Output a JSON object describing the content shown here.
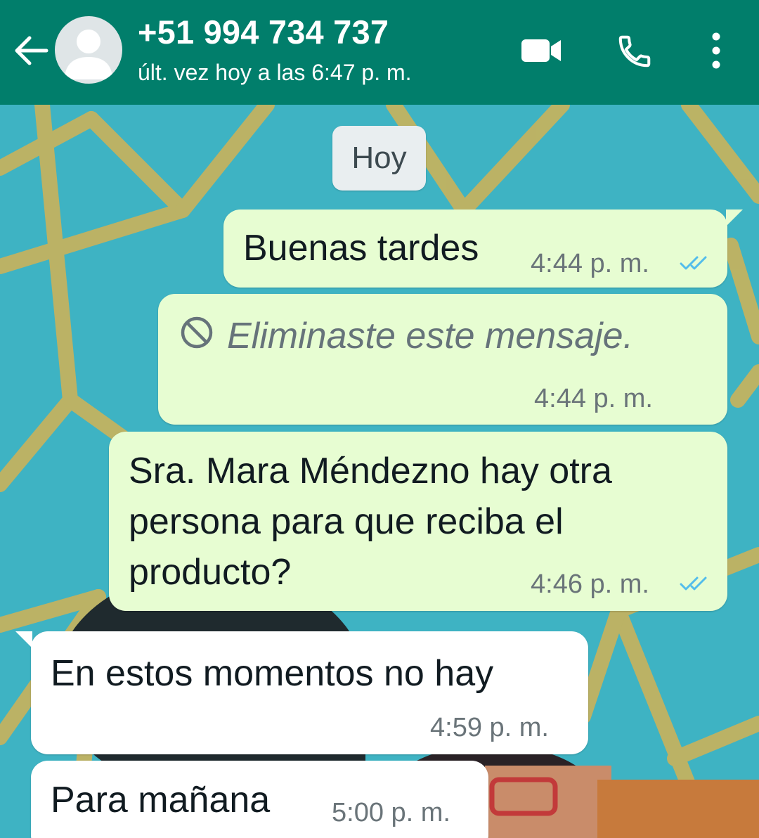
{
  "header": {
    "contact_name": "+51 994 734 737",
    "status": "últ. vez hoy a las 6:47 p. m.",
    "colors": {
      "bar": "#017e6b"
    },
    "icons": [
      "back-arrow-icon",
      "avatar-placeholder-icon",
      "video-camera-icon",
      "phone-icon",
      "more-vertical-icon"
    ]
  },
  "chat": {
    "date_chip": "Hoy",
    "messages": [
      {
        "direction": "outgoing",
        "text": "Buenas tardes",
        "time": "4:44 p. m.",
        "status": "read"
      },
      {
        "direction": "outgoing",
        "deleted": true,
        "text": "Eliminaste este mensaje.",
        "time": "4:44 p. m."
      },
      {
        "direction": "outgoing",
        "lines": [
          "Sra. Mara Méndezno hay otra",
          "persona para que reciba el",
          "producto?"
        ],
        "time": "4:46 p. m.",
        "status": "read"
      },
      {
        "direction": "incoming",
        "text": "En estos momentos no hay",
        "time": "4:59 p. m."
      },
      {
        "direction": "incoming",
        "text": "Para mañana",
        "time": "5:00 p. m."
      }
    ],
    "colors": {
      "outgoing_bubble": "#e7fdd2",
      "incoming_bubble": "#ffffff",
      "read_ticks": "#53bdeb"
    }
  }
}
